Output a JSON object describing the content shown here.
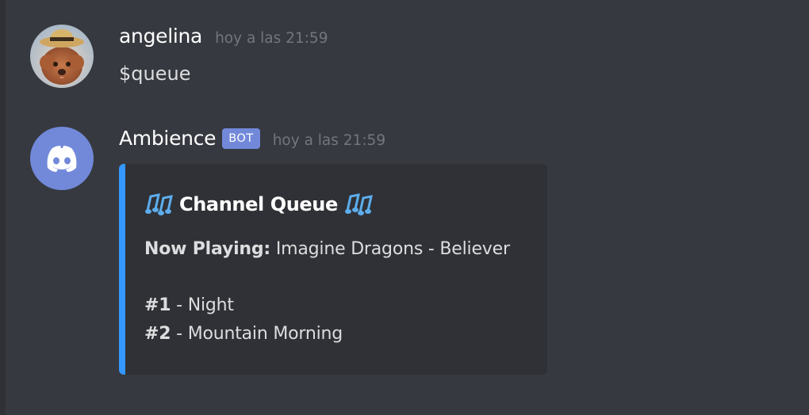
{
  "messages": [
    {
      "username": "angelina",
      "timestamp": "hoy a las 21:59",
      "text": "$queue",
      "avatar": "poodle-with-straw-hat"
    },
    {
      "username": "Ambience",
      "bot_tag": "BOT",
      "timestamp": "hoy a las 21:59",
      "avatar": "discord-logo",
      "embed": {
        "accent_color": "#3498ff",
        "title": "Channel Queue",
        "title_icon": "musical-notes-icon",
        "now_playing_label": "Now Playing:",
        "now_playing_value": "Imagine Dragons - Believer",
        "queue": [
          {
            "number": "#1",
            "separator": "-",
            "title": "Night"
          },
          {
            "number": "#2",
            "separator": "-",
            "title": "Mountain Morning"
          }
        ]
      }
    }
  ],
  "colors": {
    "background": "#36393f",
    "embed_background": "#2f3136",
    "bot_tag": "#7289da",
    "discord_blurple": "#7289da",
    "timestamp": "#72767d"
  }
}
